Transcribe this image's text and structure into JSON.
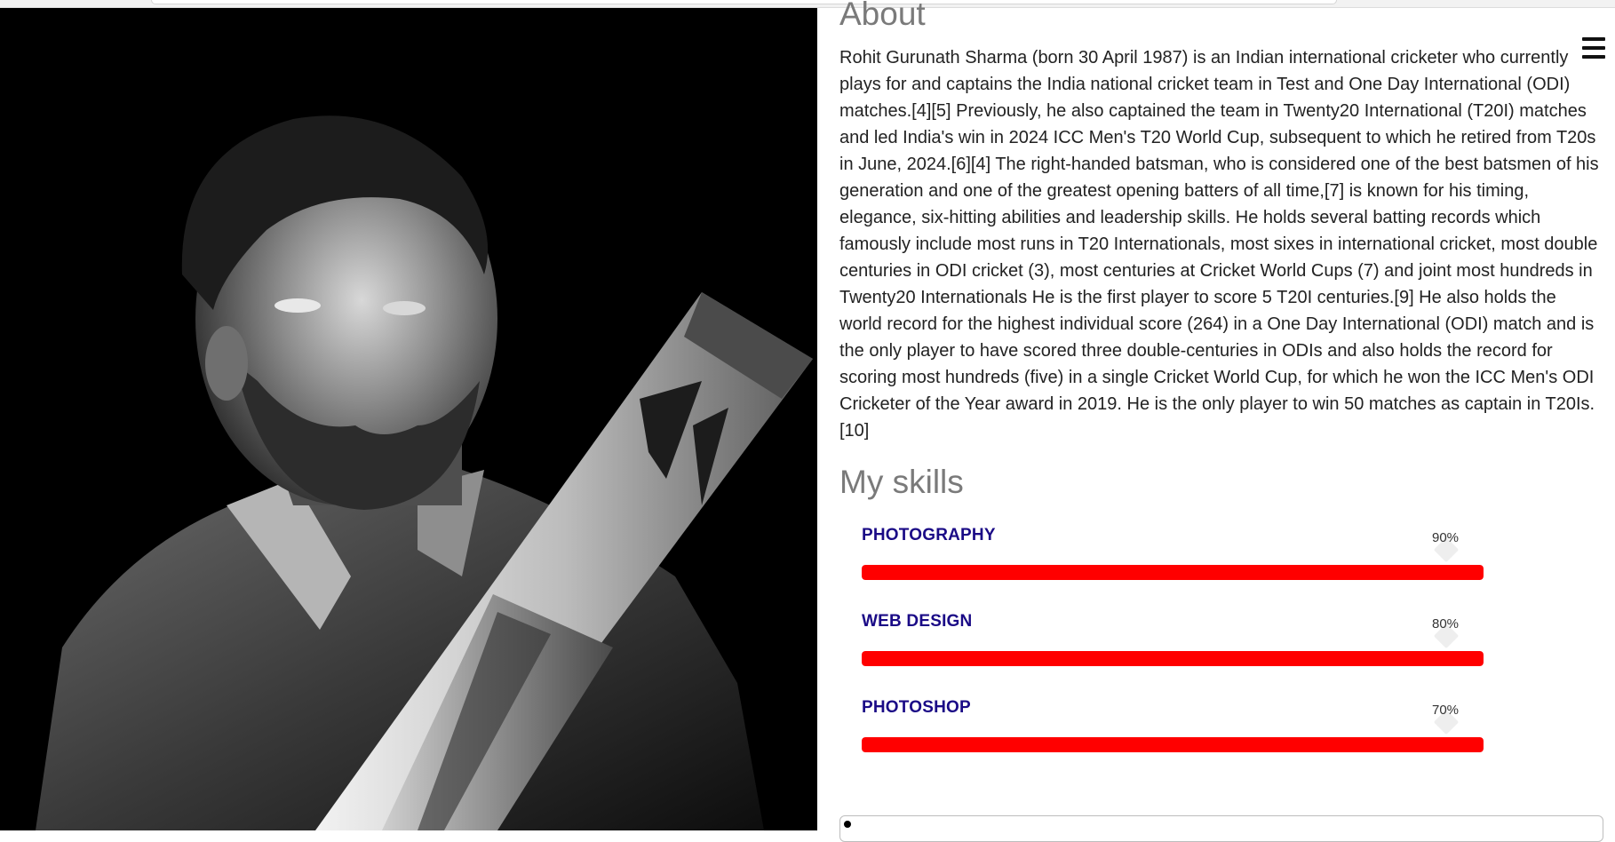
{
  "about": {
    "heading": "About",
    "text": "Rohit Gurunath Sharma (born 30 April 1987) is an Indian international cricketer who currently plays for and captains the India national cricket team in Test and One Day International (ODI) matches.[4][5] Previously, he also captained the team in Twenty20 International (T20I) matches and led India's win in 2024 ICC Men's T20 World Cup, subsequent to which he retired from T20s in June, 2024.[6][4] The right-handed batsman, who is considered one of the best batsmen of his generation and one of the greatest opening batters of all time,[7] is known for his timing, elegance, six-hitting abilities and leadership skills. He holds several batting records which famously include most runs in T20 Internationals, most sixes in international cricket, most double centuries in ODI cricket (3), most centuries at Cricket World Cups (7) and joint most hundreds in Twenty20 Internationals He is the first player to score 5 T20I centuries.[9] He also holds the world record for the highest individual score (264) in a One Day International (ODI) match and is the only player to have scored three double-centuries in ODIs and also holds the record for scoring most hundreds (five) in a single Cricket World Cup, for which he won the ICC Men's ODI Cricketer of the Year award in 2019. He is the only player to win 50 matches as captain in T20Is.[10]"
  },
  "skills": {
    "heading": "My skills",
    "items": [
      {
        "name": "PHOTOGRAPHY",
        "percent_label": "90%",
        "level": 90
      },
      {
        "name": "WEB DESIGN",
        "percent_label": "80%",
        "level": 80
      },
      {
        "name": "PHOTOSHOP",
        "percent_label": "70%",
        "level": 70
      }
    ],
    "bar_color": "#ff0000",
    "name_color": "#1a0a86"
  },
  "icons": {
    "menu": "hamburger-menu-icon"
  }
}
